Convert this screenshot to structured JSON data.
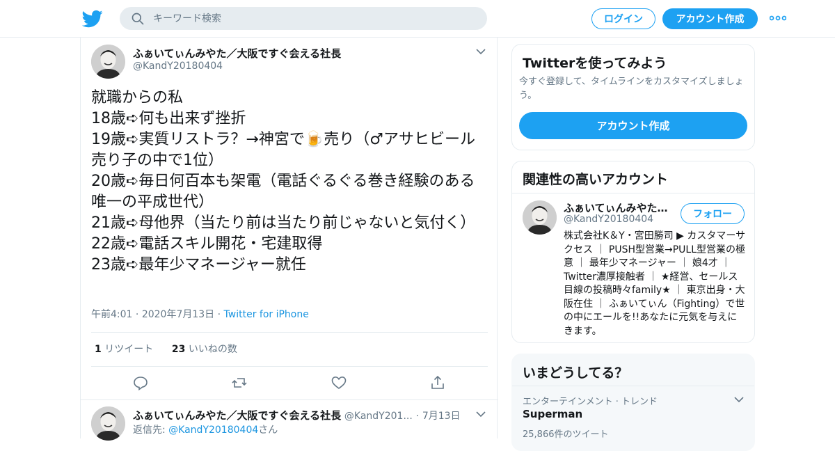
{
  "header": {
    "search_placeholder": "キーワード検索",
    "login_label": "ログイン",
    "signup_label": "アカウント作成"
  },
  "tweet": {
    "display_name": "ふぁいてぃんみやた／大阪ですぐ会える社長",
    "handle": "@KandY20180404",
    "text": "就職からの私\n18歳➪何も出来ず挫折\n19歳➪実質リストラ？→神宮で🍺売り（♂アサヒビール売り子の中で1位）\n20歳➪毎日何百本も架電（電話ぐるぐる巻き経験のある唯一の平成世代）\n21歳➪母他界（当たり前は当たり前じゃないと気付く）\n22歳➪電話スキル開花・宅建取得\n23歳➪最年少マネージャー就任",
    "time": "午前4:01",
    "date": "2020年7月13日",
    "source": "Twitter for iPhone",
    "retweet_count": "1",
    "retweet_label": "リツイート",
    "like_count": "23",
    "like_label": "いいねの数"
  },
  "reply": {
    "display_name": "ふぁいてぃんみやた／大阪ですぐ会える社長",
    "handle": "@KandY201...",
    "date": "7月13日",
    "reply_prefix": "返信先: ",
    "reply_to": "@KandY20180404",
    "reply_suffix": "さん"
  },
  "signup_card": {
    "title": "Twitterを使ってみよう",
    "description": "今すぐ登録して、タイムラインをカスタマイズしましょう。",
    "button_label": "アカウント作成"
  },
  "related_card": {
    "title": "関連性の高いアカウント",
    "name": "ふぁいてぃんみやた…",
    "handle": "@KandY20180404",
    "follow_label": "フォロー",
    "bio": "株式会社K＆Y・宮田勝司 ▶ カスタマーサクセス ｜ PUSH型営業→PULL型営業の極意 ｜ 最年少マネージャー ｜ 娘4才 ｜ Twitter濃厚接触者 ｜ ★経営、セールス目線の投稿時々family★ ｜ 東京出身・大阪在住 ｜ ふぁいてぃん（Fighting）で世の中にエールを!!あなたに元気を与えにきます。"
  },
  "trends_card": {
    "title": "いまどうしてる？",
    "category": "エンターテインメント · トレンド",
    "name": "Superman",
    "count": "25,866件のツイート"
  },
  "colors": {
    "accent": "#1da1f2",
    "link": "#1b95e0",
    "muted": "#657786",
    "border": "#e6ecf0"
  }
}
